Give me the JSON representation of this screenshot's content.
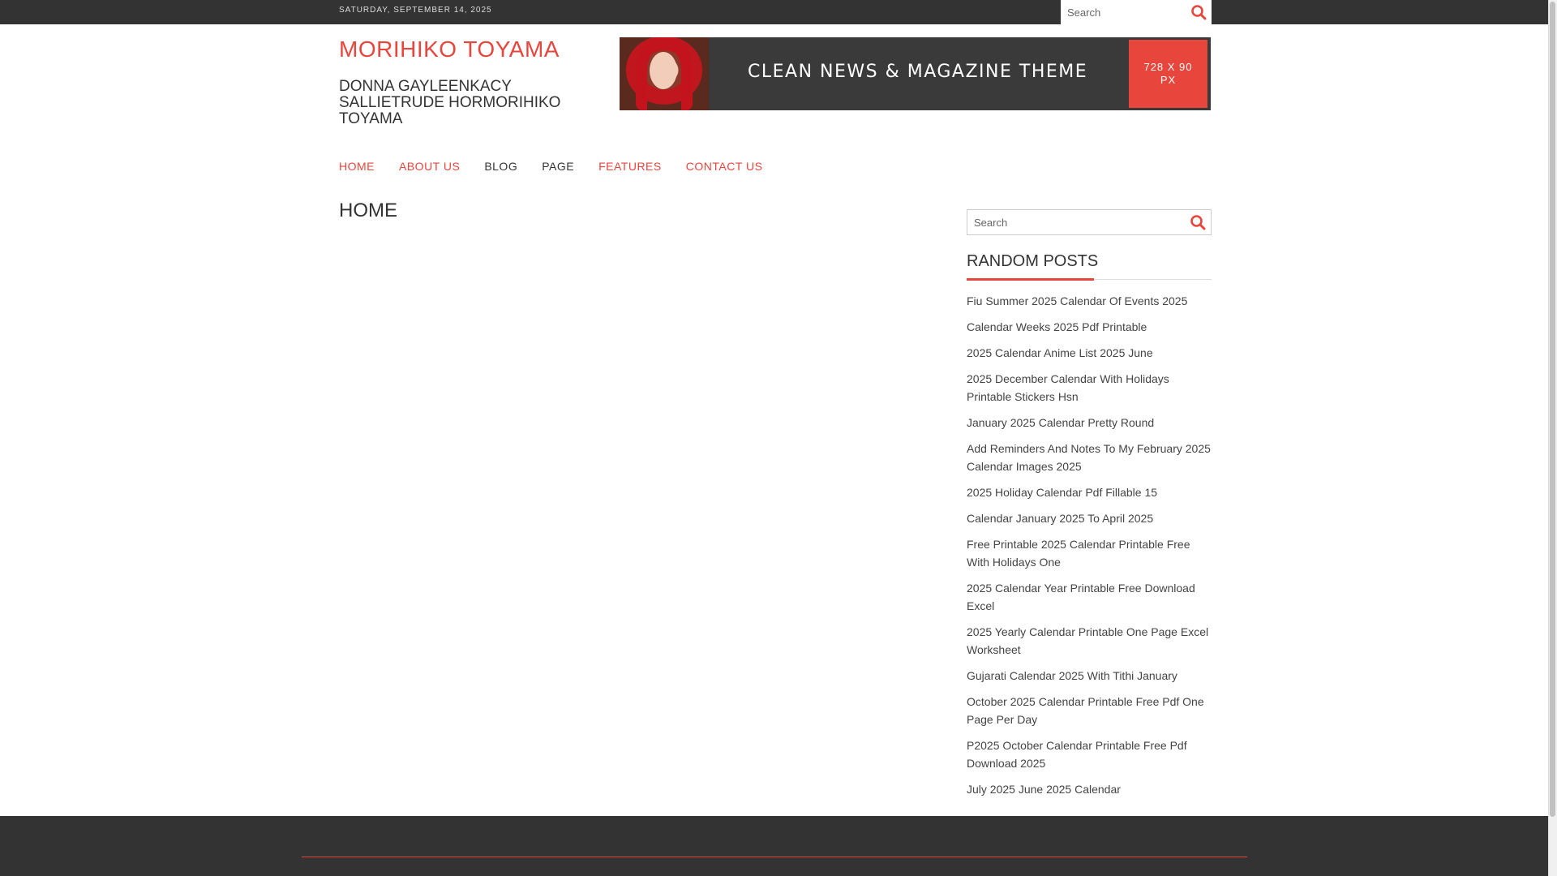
{
  "topbar": {
    "date": "SATURDAY, SEPTEMBER 14, 2025",
    "search_placeholder": "Search"
  },
  "header": {
    "site_title": "MORIHIKO TOYAMA",
    "site_description": "DONNA GAYLEENKACY SALLIETRUDE HORMORIHIKO TOYAMA"
  },
  "banner": {
    "tagline": "CLEAN NEWS & MAGAZINE THEME",
    "size_label": "728 X 90 PX"
  },
  "nav": {
    "items": [
      {
        "label": "HOME",
        "color": "#e8453c"
      },
      {
        "label": "ABOUT US",
        "color": "#e8453c"
      },
      {
        "label": "BLOG",
        "color": "#333333"
      },
      {
        "label": "PAGE",
        "color": "#333333"
      },
      {
        "label": "FEATURES",
        "color": "#e8453c"
      },
      {
        "label": "CONTACT US",
        "color": "#e8453c"
      }
    ]
  },
  "main": {
    "page_heading": "HOME"
  },
  "sidebar": {
    "search_placeholder": "Search",
    "widget_title": "RANDOM POSTS",
    "posts": [
      "Fiu Summer 2025 Calendar Of Events 2025",
      "Calendar Weeks 2025 Pdf Printable",
      "2025 Calendar Anime List 2025 June",
      "2025 December Calendar With Holidays Printable Stickers Hsn",
      "January 2025 Calendar Pretty Round",
      "Add Reminders And Notes To My February 2025 Calendar Images 2025",
      "2025 Holiday Calendar Pdf Fillable 15",
      "Calendar January 2025 To April 2025",
      "Free Printable 2025 Calendar Printable Free With Holidays One",
      "2025 Calendar Year Printable Free Download Excel",
      "2025 Yearly Calendar Printable One Page Excel Worksheet",
      "Gujarati Calendar 2025 With Tithi January",
      "October 2025 Calendar Printable Free Pdf One Page Per Day",
      "P2025 October Calendar Printable Free Pdf Download 2025",
      "July 2025 June 2025 Calendar"
    ]
  },
  "colors": {
    "accent": "#e8453c",
    "dark_bar": "#333333",
    "text": "#333333"
  },
  "icons": {
    "search": "search-icon"
  }
}
